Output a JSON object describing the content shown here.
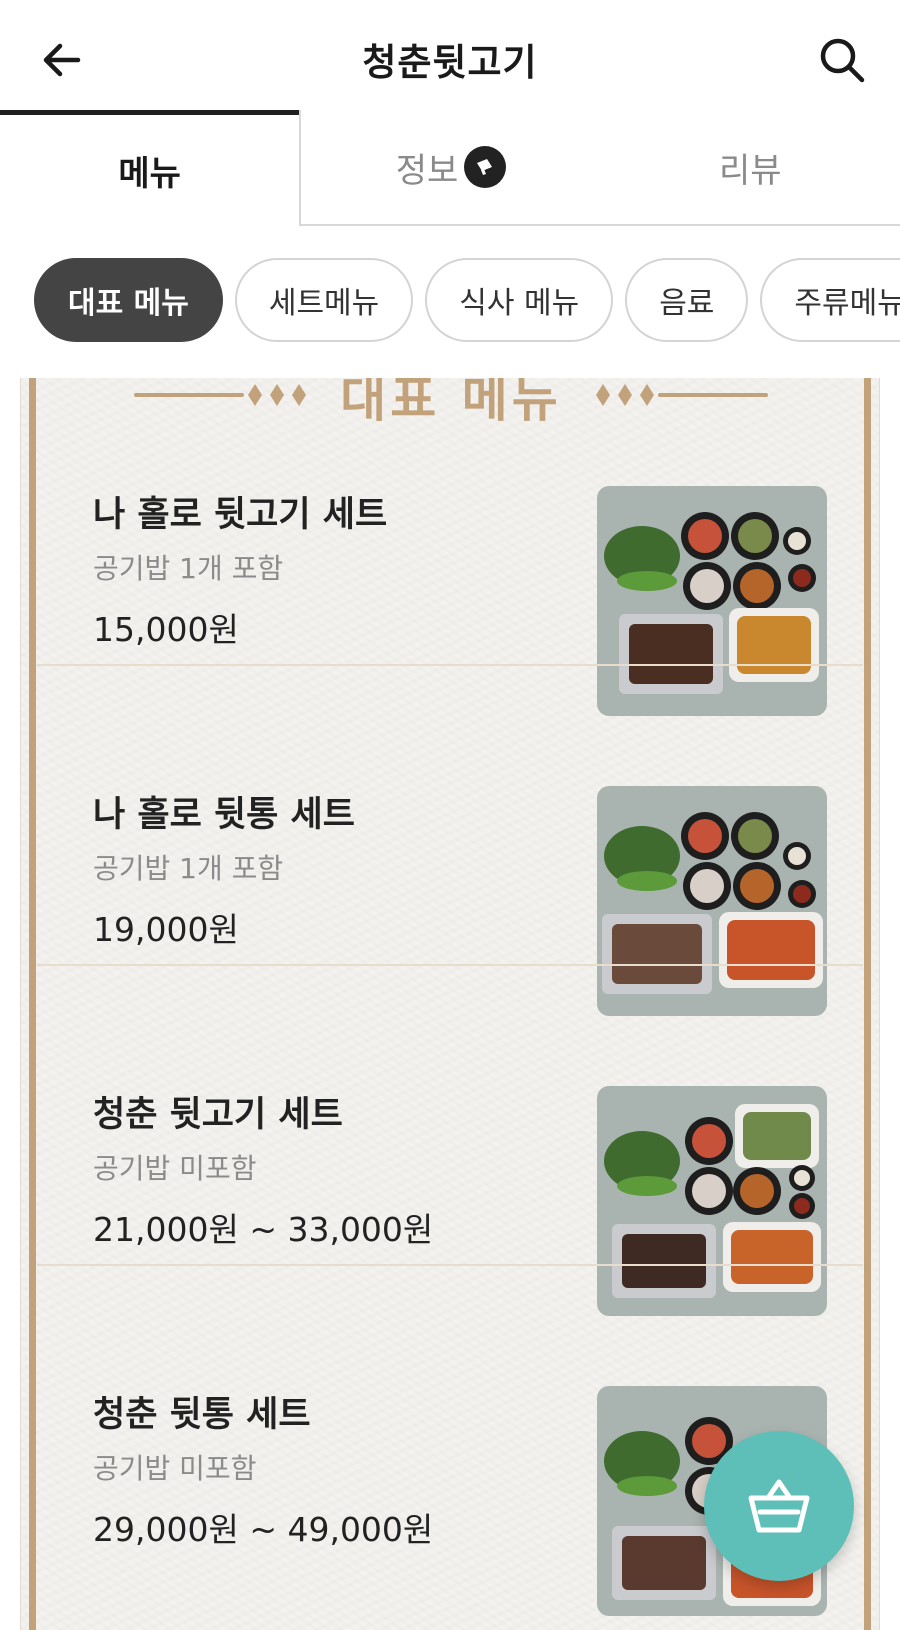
{
  "header": {
    "title": "청춘뒷고기",
    "back_icon": "arrow-left-icon",
    "search_icon": "search-icon"
  },
  "tabs": [
    {
      "label": "메뉴",
      "active": true
    },
    {
      "label": "정보",
      "active": false,
      "badge_icon": "megaphone-icon"
    },
    {
      "label": "리뷰",
      "active": false
    }
  ],
  "chips": [
    {
      "label": "대표 메뉴",
      "active": true
    },
    {
      "label": "세트메뉴",
      "active": false
    },
    {
      "label": "식사 메뉴",
      "active": false
    },
    {
      "label": "음료",
      "active": false
    },
    {
      "label": "주류메뉴",
      "active": false
    }
  ],
  "section": {
    "title": "대표 메뉴"
  },
  "menu_items": [
    {
      "name": "나 홀로 뒷고기 세트",
      "desc": "공기밥 1개 포함",
      "price": "15,000원"
    },
    {
      "name": "나 홀로 뒷통 세트",
      "desc": "공기밥 1개 포함",
      "price": "19,000원"
    },
    {
      "name": "청춘 뒷고기 세트",
      "desc": "공기밥 미포함",
      "price": "21,000원 ~ 33,000원"
    },
    {
      "name": "청춘 뒷통 세트",
      "desc": "공기밥 미포함",
      "price": "29,000원 ~ 49,000원"
    }
  ],
  "colors": {
    "accent_gold": "#c2a27a",
    "cart_button": "#5dbfb8",
    "chip_active": "#444444"
  },
  "cart": {
    "icon": "shopping-basket-icon"
  }
}
